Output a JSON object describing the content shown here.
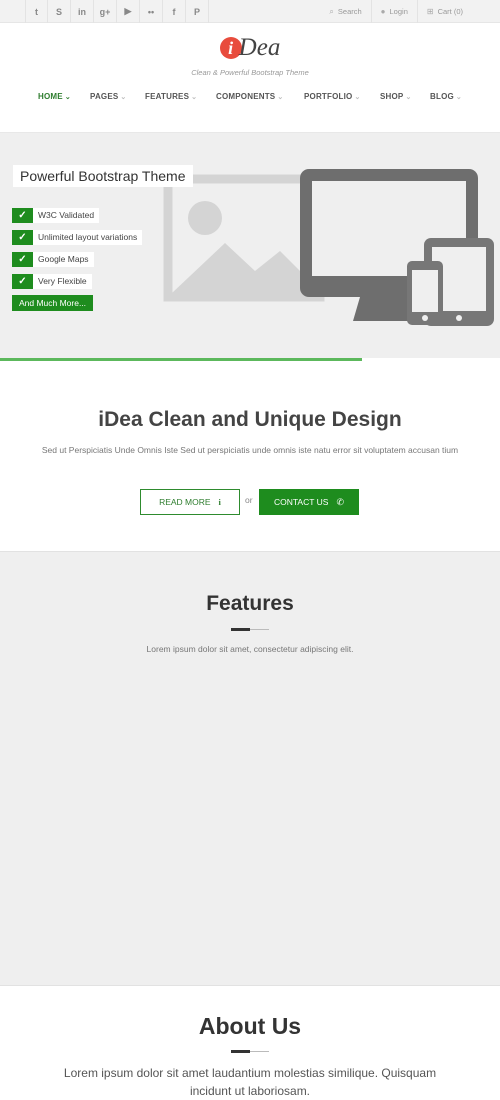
{
  "topbar": {
    "social": [
      {
        "name": "twitter-icon",
        "glyph": "t"
      },
      {
        "name": "skype-icon",
        "glyph": "S"
      },
      {
        "name": "linkedin-icon",
        "glyph": "in"
      },
      {
        "name": "google-plus-icon",
        "glyph": "g+"
      },
      {
        "name": "youtube-icon",
        "glyph": "▶"
      },
      {
        "name": "flickr-icon",
        "glyph": "••"
      },
      {
        "name": "facebook-icon",
        "glyph": "f"
      },
      {
        "name": "pinterest-icon",
        "glyph": "P"
      }
    ],
    "search_label": "Search",
    "login_label": "Login",
    "cart_label": "Cart (0)"
  },
  "header": {
    "logo_letter": "i",
    "logo_text": "Dea",
    "tagline": "Clean & Powerful Bootstrap Theme"
  },
  "nav": {
    "items": [
      "HOME",
      "PAGES",
      "FEATURES",
      "COMPONENTS",
      "PORTFOLIO",
      "SHOP",
      "BLOG"
    ],
    "active": "HOME"
  },
  "hero": {
    "title": "Powerful Bootstrap Theme",
    "features": [
      "W3C Validated",
      "Unlimited layout variations",
      "Google Maps",
      "Very Flexible"
    ],
    "more_button": "And Much More..."
  },
  "design": {
    "title": "iDea Clean and Unique Design",
    "text": "Sed ut Perspiciatis Unde Omnis Iste Sed ut perspiciatis unde omnis iste natu error sit voluptatem accusan tium",
    "read_more": "READ MORE",
    "or": "or",
    "contact": "CONTACT US"
  },
  "features": {
    "title": "Features",
    "text": "Lorem ipsum dolor sit amet, consectetur adipiscing elit."
  },
  "about": {
    "title": "About Us",
    "text": "Lorem ipsum dolor sit amet laudantium molestias similique. Quisquam incidunt ut laboriosam."
  },
  "colors": {
    "accent": "#1e8c1e",
    "progress_bar": "#5cb85c",
    "logo": "#e84c3d"
  }
}
